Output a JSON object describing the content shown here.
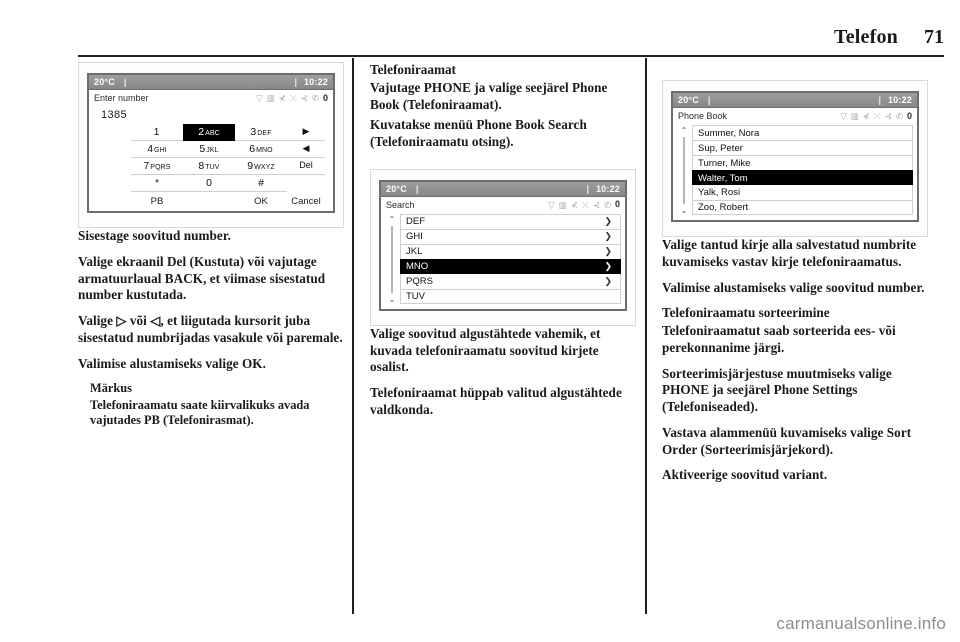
{
  "page": {
    "chapter_title": "Telefon",
    "page_number": "71",
    "footer_watermark": "carmanualsonline.info"
  },
  "column1": {
    "screenshot": {
      "status": {
        "temperature": "20°C",
        "separator": "|",
        "clock": "10:22",
        "clock_separator": "|"
      },
      "title": "Enter number",
      "status_icons": [
        "wifi-icon",
        "sim-card-icon",
        "mute-icon",
        "shuffle-icon",
        "speaker-off-icon",
        "phone-handset-icon",
        "battery-icon"
      ],
      "entered_number": "1385",
      "keys": [
        {
          "digit": "1",
          "letters": "",
          "selected": false
        },
        {
          "digit": "2",
          "letters": "ABC",
          "selected": true
        },
        {
          "digit": "3",
          "letters": "DEF",
          "selected": false
        },
        {
          "digit": "4",
          "letters": "GHI",
          "selected": false
        },
        {
          "digit": "5",
          "letters": "JKL",
          "selected": false
        },
        {
          "digit": "6",
          "letters": "MNO",
          "selected": false
        },
        {
          "digit": "7",
          "letters": "PQRS",
          "selected": false
        },
        {
          "digit": "8",
          "letters": "TUV",
          "selected": false
        },
        {
          "digit": "9",
          "letters": "WXYZ",
          "selected": false
        },
        {
          "digit": "*",
          "letters": "",
          "selected": false
        },
        {
          "digit": "0",
          "letters": "",
          "selected": false
        },
        {
          "digit": "#",
          "letters": "",
          "selected": false
        }
      ],
      "side_keys": [
        {
          "label": "▶",
          "name": "cursor-right-icon"
        },
        {
          "label": "◀",
          "name": "cursor-left-icon"
        },
        {
          "label": "Del",
          "name": "delete-key"
        }
      ],
      "softkeys": [
        {
          "label": "PB",
          "name": "phonebook-softkey"
        },
        {
          "label": "OK",
          "name": "ok-softkey"
        },
        {
          "label": "Cancel",
          "name": "cancel-softkey"
        }
      ]
    },
    "paragraphs": [
      "Sisestage soovitud number.",
      "Valige ekraanil Del (Kustuta) või vajutage armatuurlaual BACK, et viimase sisestatud number kustutada.",
      "Valige ▷ või ◁, et liigutada kursorit juba sisestatud numbrijadas vasakule või paremale.",
      "Valimise alustamiseks valige OK."
    ],
    "note": {
      "title": "Märkus",
      "body": "Telefoniraamatu saate kiirvalikuks avada vajutades PB (Telefonirasmat)."
    }
  },
  "column2": {
    "heading": "Telefoniraamat",
    "paragraphs_top": [
      "Vajutage PHONE ja valige seejärel Phone Book (Telefoniraamat).",
      "Kuvatakse menüü Phone Book Search (Telefoniraamatu otsing)."
    ],
    "screenshot": {
      "status": {
        "temperature": "20°C",
        "separator": "|",
        "clock": "10:22",
        "clock_separator": "|"
      },
      "title": "Search",
      "status_icons": [
        "wifi-icon",
        "sim-card-icon",
        "mute-icon",
        "shuffle-icon",
        "speaker-off-icon",
        "phone-handset-icon",
        "battery-icon"
      ],
      "scroll_up": "⌃",
      "scroll_down": "⌄",
      "rows": [
        {
          "label": "DEF",
          "chevron": "❯",
          "selected": false
        },
        {
          "label": "GHI",
          "chevron": "❯",
          "selected": false
        },
        {
          "label": "JKL",
          "chevron": "❯",
          "selected": false
        },
        {
          "label": "MNO",
          "chevron": "❯",
          "selected": true
        },
        {
          "label": "PQRS",
          "chevron": "❯",
          "selected": false
        },
        {
          "label": "TUV",
          "chevron": "",
          "selected": false
        }
      ]
    },
    "paragraphs_bottom": [
      "Valige soovitud algustähtede vahemik, et kuvada telefoniraamatu soovitud kirjete osalist.",
      "Telefoniraamat hüppab valitud algustähtede valdkonda."
    ]
  },
  "column3": {
    "screenshot": {
      "status": {
        "temperature": "20°C",
        "separator": "|",
        "clock": "10:22",
        "clock_separator": "|"
      },
      "title": "Phone Book",
      "status_icons": [
        "wifi-icon",
        "sim-card-icon",
        "mute-icon",
        "shuffle-icon",
        "speaker-off-icon",
        "phone-handset-icon",
        "battery-icon"
      ],
      "scroll_up": "⌃",
      "scroll_down": "⌄",
      "rows": [
        {
          "label": "Summer, Nora",
          "selected": false
        },
        {
          "label": "Sup, Peter",
          "selected": false
        },
        {
          "label": "Turner, Mike",
          "selected": false
        },
        {
          "label": "Walter, Tom",
          "selected": true
        },
        {
          "label": "Yalk, Rosi",
          "selected": false
        },
        {
          "label": "Zoo, Robert",
          "selected": false
        }
      ]
    },
    "paragraphs_top": [
      "Valige tantud kirje alla salvestatud numbrite kuvamiseks vastav kirje telefoniraamatus.",
      "Valimise alustamiseks valige soovitud number."
    ],
    "heading_sort": "Telefoniraamatu sorteerimine",
    "paragraphs_bottom": [
      "Telefoniraamatut saab sorteerida ees- või perekonnanime järgi.",
      "Sorteerimisjärjestuse muutmiseks valige PHONE ja seejärel Phone Settings (Telefoniseaded).",
      "Vastava alammenüü kuvamiseks valige Sort Order (Sorteerimisjärjekord).",
      "Aktiveerige soovitud variant."
    ]
  }
}
